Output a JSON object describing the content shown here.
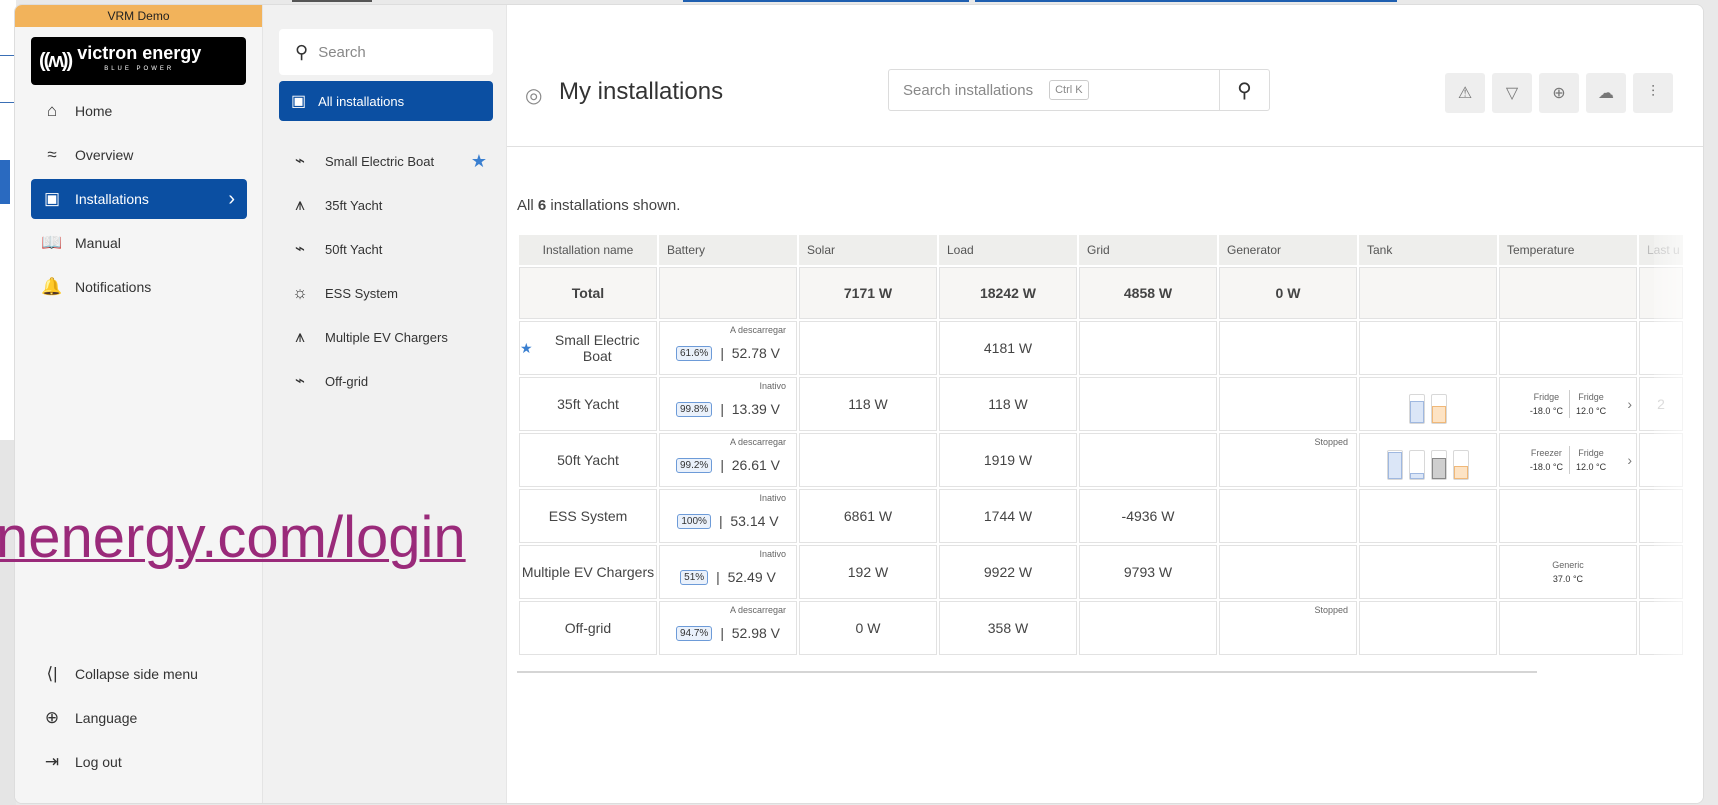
{
  "app": {
    "demo_banner": "VRM Demo",
    "logo_text": "victron energy",
    "logo_sub": "BLUE POWER"
  },
  "nav": {
    "items": [
      {
        "label": "Home",
        "icon": "home-icon"
      },
      {
        "label": "Overview",
        "icon": "overview-icon"
      },
      {
        "label": "Installations",
        "icon": "installations-icon",
        "active": true
      },
      {
        "label": "Manual",
        "icon": "book-icon"
      },
      {
        "label": "Notifications",
        "icon": "bell-icon"
      }
    ],
    "bottom": [
      {
        "label": "Collapse side menu",
        "icon": "collapse-icon"
      },
      {
        "label": "Language",
        "icon": "globe-icon"
      },
      {
        "label": "Log out",
        "icon": "logout-icon"
      }
    ]
  },
  "list": {
    "search_placeholder": "Search",
    "all_label": "All installations",
    "items": [
      {
        "label": "Small Electric Boat",
        "starred": true
      },
      {
        "label": "35ft Yacht"
      },
      {
        "label": "50ft Yacht"
      },
      {
        "label": "ESS System"
      },
      {
        "label": "Multiple EV Chargers"
      },
      {
        "label": "Off-grid"
      }
    ]
  },
  "main": {
    "title": "My installations",
    "search_placeholder": "Search installations",
    "shortcut": "Ctrl K",
    "shown_prefix": "All ",
    "shown_count": "6",
    "shown_suffix": " installations shown."
  },
  "table": {
    "headers": [
      "Installation name",
      "Battery",
      "Solar",
      "Load",
      "Grid",
      "Generator",
      "Tank",
      "Temperature",
      "Last u"
    ],
    "total": {
      "name": "Total",
      "solar": "7171 W",
      "load": "18242 W",
      "grid": "4858 W",
      "generator": "0 W"
    },
    "rows": [
      {
        "name": "Small Electric Boat",
        "state": "A descarregar",
        "soc": "61.6%",
        "voltage": "52.78 V",
        "solar": "",
        "load": "4181 W",
        "grid": "",
        "generator": ""
      },
      {
        "name": "35ft Yacht",
        "state": "Inativo",
        "soc": "99.8%",
        "voltage": "13.39 V",
        "solar": "118 W",
        "load": "118 W",
        "grid": "",
        "generator": "",
        "temp1_label": "Fridge",
        "temp1": "-18.0 °C",
        "temp2_label": "Fridge",
        "temp2": "12.0 °C",
        "last": "2"
      },
      {
        "name": "50ft Yacht",
        "state": "A descarregar",
        "soc": "99.2%",
        "voltage": "26.61 V",
        "solar": "",
        "load": "1919 W",
        "grid": "",
        "generator_state": "Stopped",
        "temp1_label": "Freezer",
        "temp1": "-18.0 °C",
        "temp2_label": "Fridge",
        "temp2": "12.0 °C"
      },
      {
        "name": "ESS System",
        "state": "Inativo",
        "soc": "100%",
        "voltage": "53.14 V",
        "solar": "6861 W",
        "load": "1744 W",
        "grid": "-4936 W"
      },
      {
        "name": "Multiple EV Chargers",
        "state": "Inativo",
        "soc": "51%",
        "voltage": "52.49 V",
        "solar": "192 W",
        "load": "9922 W",
        "grid": "9793 W",
        "temp1_label": "Generic",
        "temp1": "37.0 °C"
      },
      {
        "name": "Off-grid",
        "state": "A descarregar",
        "soc": "94.7%",
        "voltage": "52.98 V",
        "solar": "0 W",
        "load": "358 W",
        "grid": "",
        "generator_state": "Stopped"
      }
    ]
  },
  "overlay": {
    "url_text": "nenergy.com/login"
  },
  "colors": {
    "brand_blue": "#0b4fa2",
    "demo_banner": "#f2b35b",
    "overlay_url": "#9a2a7a"
  }
}
